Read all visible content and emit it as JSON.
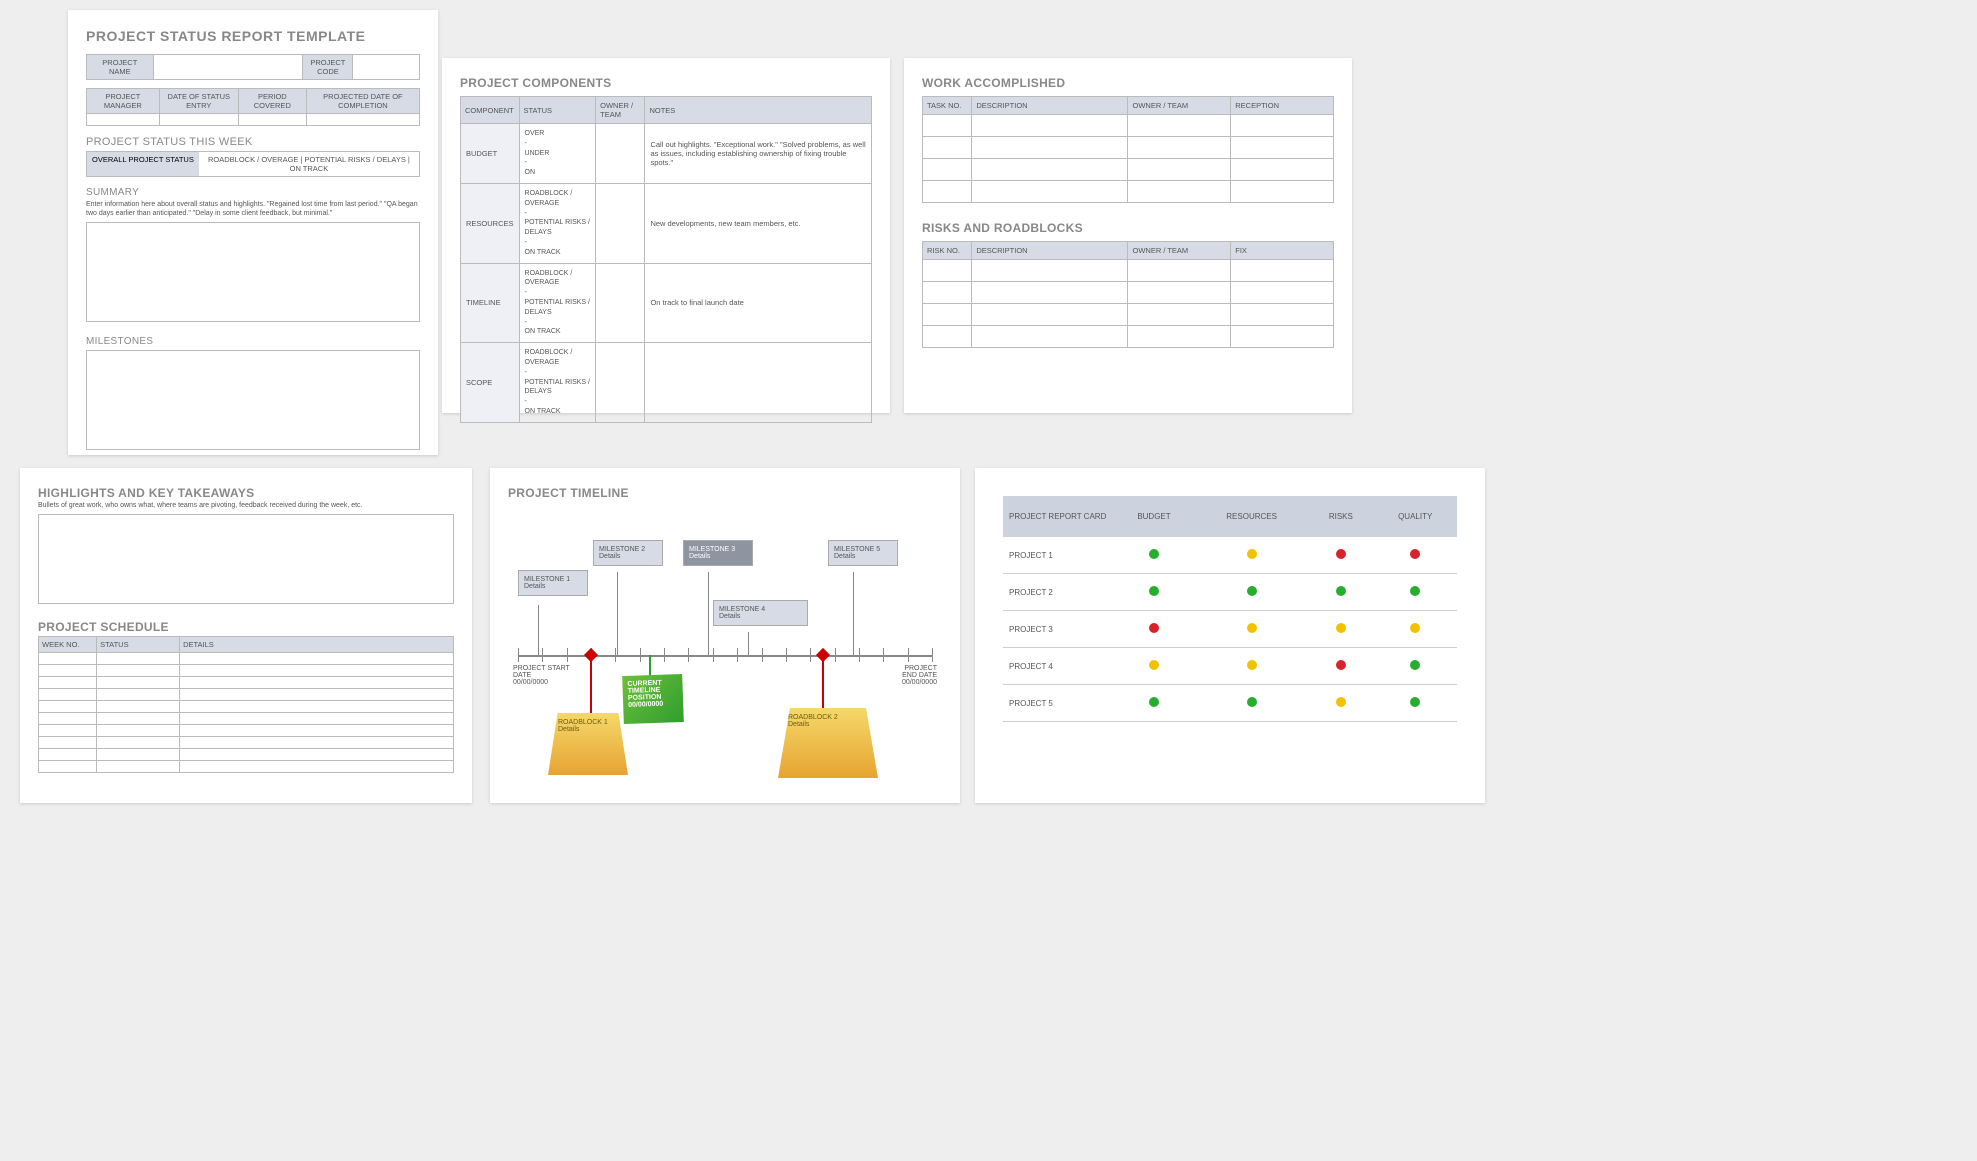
{
  "page1": {
    "title": "PROJECT STATUS REPORT TEMPLATE",
    "row1": {
      "c1": "PROJECT NAME",
      "c2": "PROJECT CODE"
    },
    "row2": {
      "c1": "PROJECT MANAGER",
      "c2": "DATE OF STATUS ENTRY",
      "c3": "PERIOD COVERED",
      "c4": "PROJECTED DATE OF COMPLETION"
    },
    "weekTitle": "PROJECT STATUS THIS WEEK",
    "statusLabel": "OVERALL PROJECT STATUS",
    "statusOptions": "ROADBLOCK / OVERAGE    |    POTENTIAL RISKS / DELAYS    |    ON TRACK",
    "summaryTitle": "SUMMARY",
    "summaryText": "Enter information here about overall status and highlights. \"Regained lost time from last period.\" \"QA began two days earlier than anticipated.\" \"Delay in some client feedback, but minimal.\"",
    "milestonesTitle": "MILESTONES"
  },
  "page2": {
    "title": "PROJECT COMPONENTS",
    "headers": [
      "COMPONENT",
      "STATUS",
      "OWNER / TEAM",
      "NOTES"
    ],
    "rows": [
      {
        "comp": "BUDGET",
        "status": "OVER\n-\nUNDER\n-\nON",
        "notes": "Call out highlights. \"Exceptional work.\" \"Solved problems, as well as issues, including establishing ownership of fixing trouble spots.\""
      },
      {
        "comp": "RESOURCES",
        "status": "ROADBLOCK / OVERAGE\n-\nPOTENTIAL RISKS / DELAYS\n-\nON TRACK",
        "notes": "New developments, new team members, etc."
      },
      {
        "comp": "TIMELINE",
        "status": "ROADBLOCK / OVERAGE\n-\nPOTENTIAL RISKS / DELAYS\n-\nON TRACK",
        "notes": "On track to final launch date"
      },
      {
        "comp": "SCOPE",
        "status": "ROADBLOCK / OVERAGE\n-\nPOTENTIAL RISKS / DELAYS\n-\nON TRACK",
        "notes": ""
      }
    ]
  },
  "page3": {
    "title1": "WORK ACCOMPLISHED",
    "headers1": [
      "TASK NO.",
      "DESCRIPTION",
      "OWNER / TEAM",
      "RECEPTION"
    ],
    "rows1": 4,
    "title2": "RISKS AND ROADBLOCKS",
    "headers2": [
      "RISK NO.",
      "DESCRIPTION",
      "OWNER / TEAM",
      "FIX"
    ],
    "rows2": 4
  },
  "page4": {
    "title1": "HIGHLIGHTS AND KEY TAKEAWAYS",
    "sub": "Bullets of great work, who owns what, where teams are pivoting, feedback received during the week, etc.",
    "title2": "PROJECT SCHEDULE",
    "headers": [
      "WEEK NO.",
      "STATUS",
      "DETAILS"
    ],
    "rows": 10
  },
  "page5": {
    "title": "PROJECT TIMELINE",
    "milestones": [
      {
        "label": "MILESTONE 1",
        "detail": "Details"
      },
      {
        "label": "MILESTONE 2",
        "detail": "Details"
      },
      {
        "label": "MILESTONE 3",
        "detail": "Details"
      },
      {
        "label": "MILESTONE 4",
        "detail": "Details"
      },
      {
        "label": "MILESTONE 5",
        "detail": "Details"
      }
    ],
    "roadblocks": [
      {
        "label": "ROADBLOCK 1",
        "detail": "Details"
      },
      {
        "label": "ROADBLOCK 2",
        "detail": "Details"
      }
    ],
    "current": "CURRENT TIMELINE POSITION 00/00/0000",
    "start": {
      "l1": "PROJECT START",
      "l2": "DATE",
      "l3": "00/00/0000"
    },
    "end": {
      "l1": "PROJECT",
      "l2": "END DATE",
      "l3": "00/00/0000"
    }
  },
  "page6": {
    "headers": [
      "PROJECT REPORT CARD",
      "BUDGET",
      "RESOURCES",
      "RISKS",
      "QUALITY"
    ],
    "rows": [
      {
        "name": "PROJECT 1",
        "cells": [
          "g",
          "y",
          "r",
          "r"
        ]
      },
      {
        "name": "PROJECT 2",
        "cells": [
          "g",
          "g",
          "g",
          "g"
        ]
      },
      {
        "name": "PROJECT 3",
        "cells": [
          "r",
          "y",
          "y",
          "y"
        ]
      },
      {
        "name": "PROJECT 4",
        "cells": [
          "y",
          "y",
          "r",
          "g"
        ]
      },
      {
        "name": "PROJECT 5",
        "cells": [
          "g",
          "g",
          "y",
          "g"
        ]
      }
    ]
  }
}
